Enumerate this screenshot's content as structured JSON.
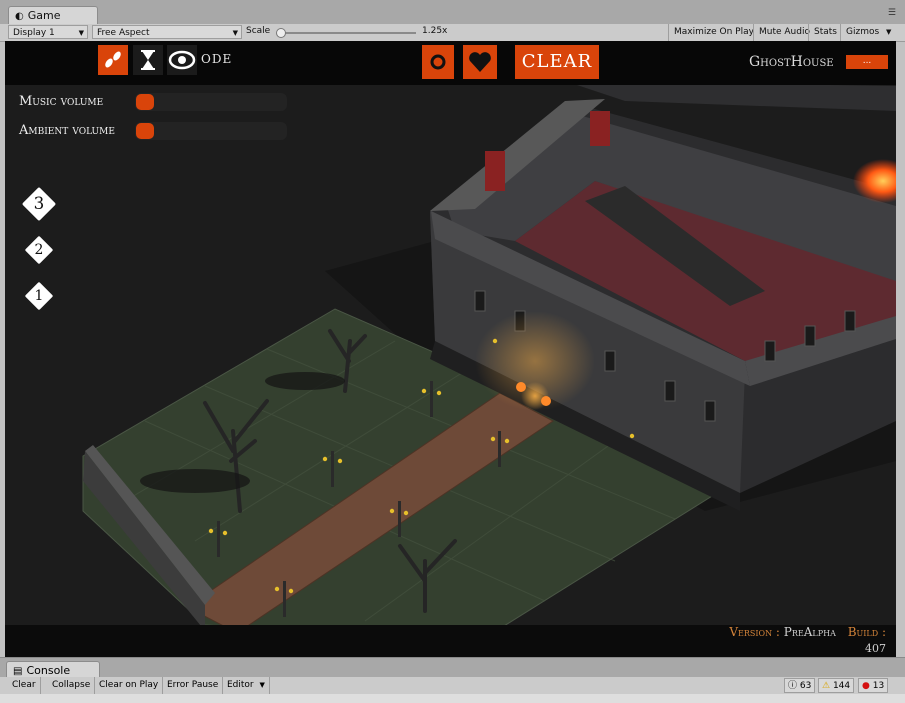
{
  "window": {
    "tab_label": "Game",
    "tab_icon": "game-icon",
    "menu_icon": "kebab-menu-icon"
  },
  "game_toolbar": {
    "display": "Display 1",
    "aspect": "Free Aspect",
    "scale_label": "Scale",
    "scale_value": "1.25x",
    "maximize_on_play": "Maximize On Play",
    "mute_audio": "Mute Audio",
    "stats": "Stats",
    "gizmos": "Gizmos"
  },
  "hud": {
    "mode_label": "ODE",
    "mode_icons": [
      "footsteps-icon",
      "hourglass-icon",
      "eye-icon"
    ],
    "ring_icon": "ring-icon",
    "heart_icon": "heart-icon",
    "clear_label": "CLEAR",
    "logo": "GhostHouse",
    "logo_badge": "...",
    "music_volume_label": "Music volume",
    "music_volume": 0,
    "ambient_volume_label": "Ambient volume",
    "ambient_volume": 0,
    "floors": [
      "3",
      "2",
      "1"
    ],
    "version_label": "Version :",
    "version_value": "PreAlpha",
    "build_label": "Build :",
    "build_value": "407"
  },
  "console": {
    "tab_label": "Console",
    "clear": "Clear",
    "collapse": "Collapse",
    "clear_on_play": "Clear on Play",
    "error_pause": "Error Pause",
    "editor": "Editor",
    "info_count": "63",
    "warning_count": "144",
    "error_count": "13"
  },
  "colors": {
    "accent": "#d9440a",
    "editor_bg": "#c2c2c2",
    "hud_bg": "#070707"
  }
}
